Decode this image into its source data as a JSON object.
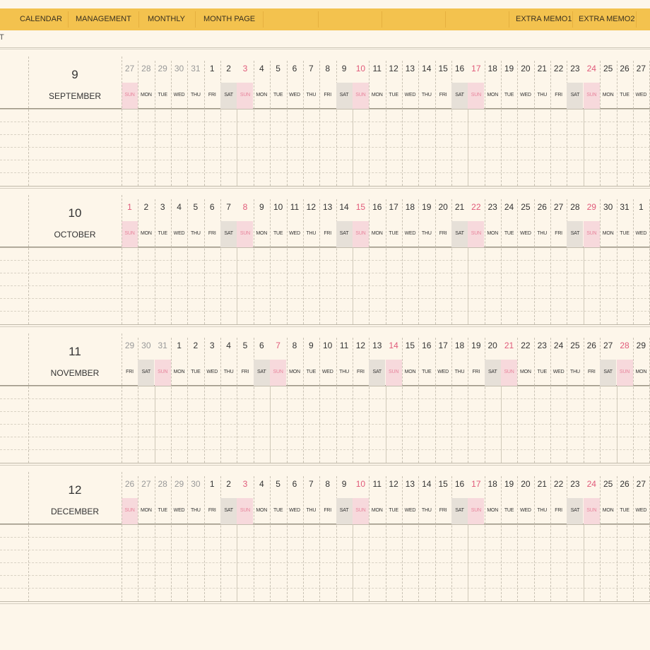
{
  "nav": {
    "tabs": [
      "CALENDAR",
      "MANAGEMENT",
      "MONTHLY",
      "MONTH PAGE"
    ],
    "extras": [
      "EXTRA MEMO1",
      "EXTRA MEMO2"
    ]
  },
  "subbar_text": "T",
  "colors": {
    "topbar": "#f3c24e",
    "background": "#fdf6ea",
    "sunday": "#e05a7a",
    "sunday_bg": "#f7d9dc",
    "saturday_bg": "#e6e0d8",
    "faded_day": "#999999"
  },
  "months": [
    {
      "number": "9",
      "name": "SEPTEMBER",
      "days": [
        "27",
        "28",
        "29",
        "30",
        "31",
        "1",
        "2",
        "3",
        "4",
        "5",
        "6",
        "7",
        "8",
        "9",
        "10",
        "11",
        "12",
        "13",
        "14",
        "15",
        "16",
        "17",
        "18",
        "19",
        "20",
        "21",
        "22",
        "23",
        "24",
        "25",
        "26",
        "27"
      ],
      "faded_days": 5
    },
    {
      "number": "10",
      "name": "OCTOBER",
      "days": [
        "1",
        "2",
        "3",
        "4",
        "5",
        "6",
        "7",
        "8",
        "9",
        "10",
        "11",
        "12",
        "13",
        "14",
        "15",
        "16",
        "17",
        "18",
        "19",
        "20",
        "21",
        "22",
        "23",
        "24",
        "25",
        "26",
        "27",
        "28",
        "29",
        "30",
        "31",
        "1"
      ],
      "faded_days": 0
    },
    {
      "number": "11",
      "name": "NOVEMBER",
      "days": [
        "29",
        "30",
        "31",
        "1",
        "2",
        "3",
        "4",
        "5",
        "6",
        "7",
        "8",
        "9",
        "10",
        "11",
        "12",
        "13",
        "14",
        "15",
        "16",
        "17",
        "18",
        "19",
        "20",
        "21",
        "22",
        "23",
        "24",
        "25",
        "26",
        "27",
        "28",
        "29"
      ],
      "faded_days": 3
    },
    {
      "number": "12",
      "name": "DECEMBER",
      "days": [
        "26",
        "27",
        "28",
        "29",
        "30",
        "1",
        "2",
        "3",
        "4",
        "5",
        "6",
        "7",
        "8",
        "9",
        "10",
        "11",
        "12",
        "13",
        "14",
        "15",
        "16",
        "17",
        "18",
        "19",
        "20",
        "21",
        "22",
        "23",
        "24",
        "25",
        "26",
        "27"
      ],
      "faded_days": 5
    }
  ],
  "weekdays": [
    "SUN",
    "MON",
    "TUE",
    "WED",
    "THU",
    "FRI",
    "SAT"
  ]
}
